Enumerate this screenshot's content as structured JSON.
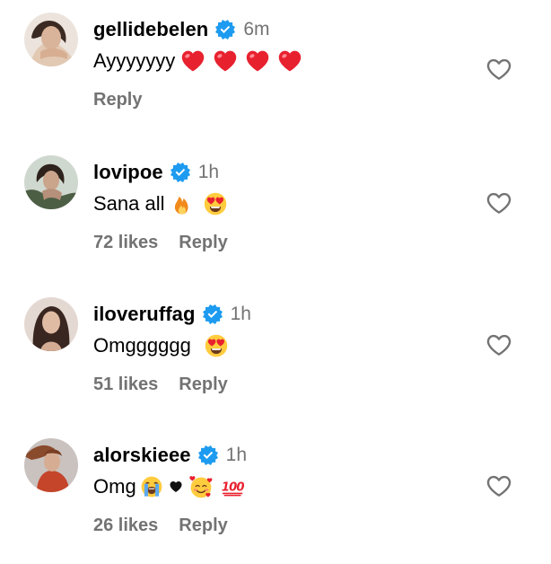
{
  "comments": [
    {
      "username": "gellidebelen",
      "verified": true,
      "time": "6m",
      "text": "Ayyyyyyy",
      "emojis": [
        "red-heart",
        "red-heart",
        "red-heart",
        "red-heart"
      ],
      "likes": "",
      "reply_label": "Reply"
    },
    {
      "username": "lovipoe",
      "verified": true,
      "time": "1h",
      "text": "Sana all",
      "emojis": [
        "fire",
        "heart-eyes"
      ],
      "likes": "72 likes",
      "reply_label": "Reply"
    },
    {
      "username": "iloveruffag",
      "verified": true,
      "time": "1h",
      "text": "Omgggggg",
      "emojis": [
        "heart-eyes"
      ],
      "likes": "51 likes",
      "reply_label": "Reply"
    },
    {
      "username": "alorskieee",
      "verified": true,
      "time": "1h",
      "text": "Omg",
      "emojis": [
        "loudly-crying",
        "black-heart",
        "smiling-with-hearts",
        "hundred-points"
      ],
      "likes": "26 likes",
      "reply_label": "Reply"
    }
  ],
  "colors": {
    "verified_badge": "#1d9bf0",
    "meta_text": "#737373",
    "heart_outline": "#737373"
  }
}
